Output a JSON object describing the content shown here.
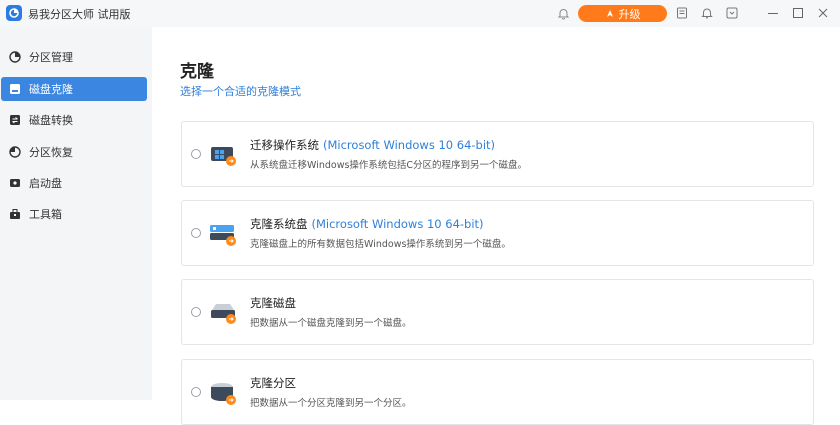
{
  "app": {
    "title": "易我分区大师 试用版",
    "upgrade_label": "升级"
  },
  "colors": {
    "accent": "#3a86e0",
    "upgrade": "#ff7a1a",
    "link": "#2f7fd9"
  },
  "sidebar": {
    "items": [
      {
        "label": "分区管理",
        "icon": "pie-chart-icon",
        "active": false
      },
      {
        "label": "磁盘克隆",
        "icon": "clone-icon",
        "active": true
      },
      {
        "label": "磁盘转换",
        "icon": "convert-icon",
        "active": false
      },
      {
        "label": "分区恢复",
        "icon": "recovery-icon",
        "active": false
      },
      {
        "label": "启动盘",
        "icon": "boot-disk-icon",
        "active": false
      },
      {
        "label": "工具箱",
        "icon": "toolbox-icon",
        "active": false
      }
    ]
  },
  "main": {
    "title": "克隆",
    "subtitle": "选择一个合适的克隆模式",
    "options": [
      {
        "title": "迁移操作系统",
        "os": "(Microsoft Windows 10 64-bit)",
        "desc": "从系统盘迁移Windows操作系统包括C分区的程序到另一个磁盘。",
        "icon": "migrate-os-icon"
      },
      {
        "title": "克隆系统盘",
        "os": "(Microsoft Windows 10 64-bit)",
        "desc": "克隆磁盘上的所有数据包括Windows操作系统到另一个磁盘。",
        "icon": "clone-system-disk-icon"
      },
      {
        "title": "克隆磁盘",
        "os": "",
        "desc": "把数据从一个磁盘克隆到另一个磁盘。",
        "icon": "clone-disk-icon"
      },
      {
        "title": "克隆分区",
        "os": "",
        "desc": "把数据从一个分区克隆到另一个分区。",
        "icon": "clone-partition-icon"
      }
    ]
  }
}
